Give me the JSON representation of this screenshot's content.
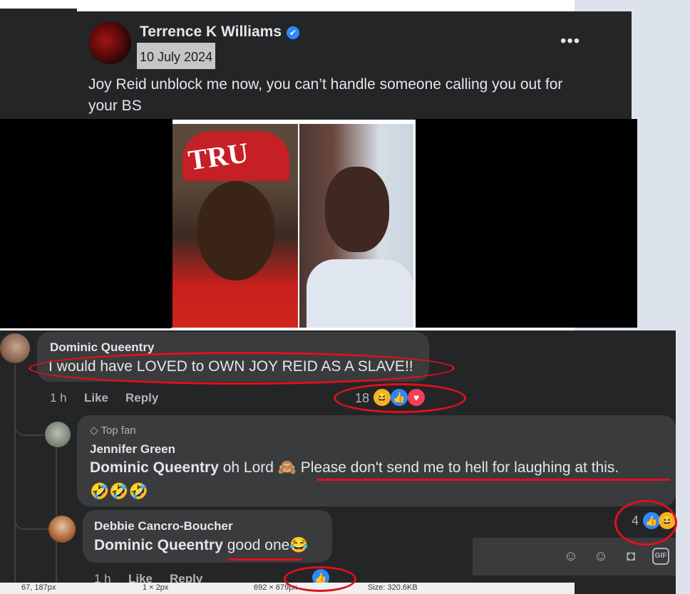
{
  "post": {
    "author": "Terrence K Williams",
    "verified_icon": "✔",
    "date": "10 July 2024",
    "more_label": "•••",
    "text": "Joy Reid unblock me now, you can’t handle someone calling you out for your BS",
    "photo_cap_text": "TRU"
  },
  "comments": [
    {
      "author": "Dominic Queentry",
      "text": "I would have LOVED to OWN JOY REID AS A SLAVE!!",
      "time": "1 h",
      "like_label": "Like",
      "reply_label": "Reply",
      "reaction_count": "18",
      "reactions": [
        "haha",
        "like",
        "love"
      ]
    },
    {
      "badge": "Top fan",
      "author": "Jennifer Green",
      "mention": "Dominic Queentry",
      "text_before": " oh Lord 🙈 ",
      "text_highlight": "Please don't send me to hell for laughing at this.",
      "text_emoji": "🤣🤣🤣",
      "reaction_count": "4",
      "reactions": [
        "like",
        "haha"
      ]
    },
    {
      "author": "Debbie Cancro-Boucher",
      "mention": "Dominic Queentry",
      "text": " good one",
      "text_emoji": "😂",
      "time": "1 h",
      "like_label": "Like",
      "reply_label": "Reply",
      "reactions": [
        "like"
      ]
    }
  ],
  "composer": {
    "icons": [
      "avatar-sticker-icon",
      "emoji-icon",
      "camera-icon",
      "gif-icon"
    ],
    "gif_label": "GIF"
  },
  "statusbar": {
    "cursor": "67, 187px",
    "selection": "1 × 2px",
    "dimensions": "692 × 679px",
    "size": "Size: 320.6KB"
  },
  "colors": {
    "annotation_red": "#e0101e",
    "facebook_blue": "#2d88ff",
    "panel_dark": "#242526"
  }
}
